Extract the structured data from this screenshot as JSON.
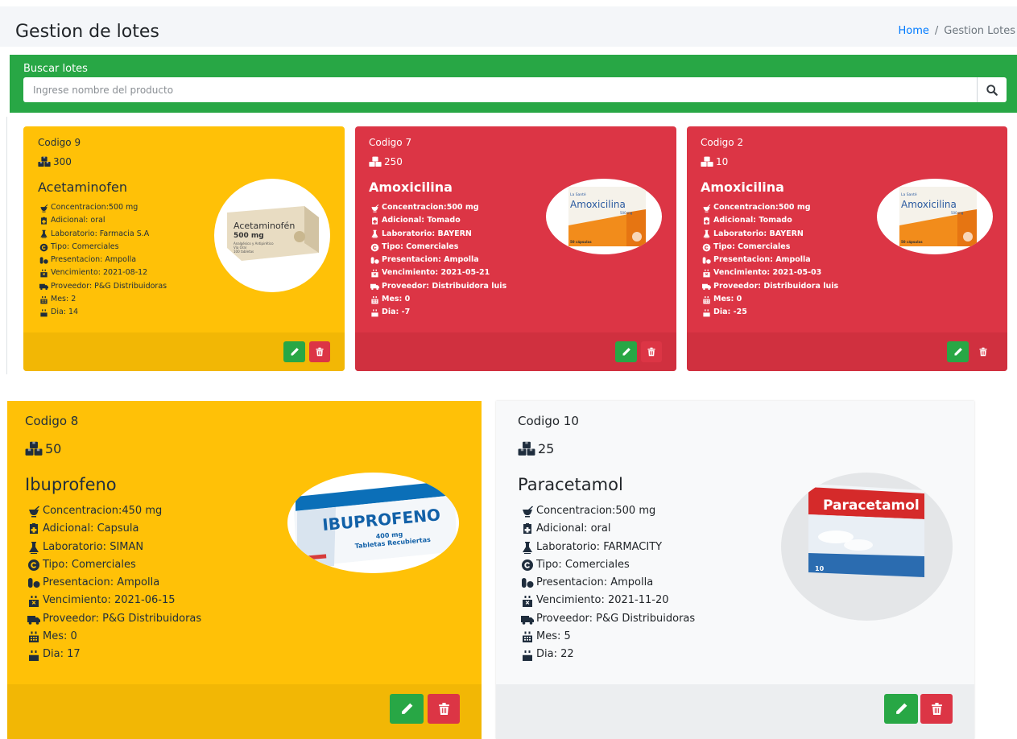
{
  "header": {
    "title": "Gestion de lotes",
    "breadcrumb": {
      "home": "Home",
      "separator": "/",
      "current": "Gestion Lotes"
    }
  },
  "search": {
    "title": "Buscar lotes",
    "placeholder": "Ingrese nombre del producto",
    "icon": "search-icon"
  },
  "colors": {
    "success": "#28a745",
    "danger": "#dc3545",
    "warning": "#ffc107",
    "light": "#f8f9fa",
    "link": "#007bff"
  },
  "cards": [
    {
      "code": "Codigo 9",
      "qty": "300",
      "name": "Acetaminofen",
      "color": "yellow",
      "image": {
        "brand": "Acetaminofén",
        "dose": "500 mg",
        "line1": "Analgésico y Antipirético",
        "line2": "Vía Oral",
        "line3": "100 tabletas"
      },
      "details": [
        "Concentracion:500 mg",
        "Adicional: oral",
        "Laboratorio: Farmacia S.A",
        "Tipo: Comerciales",
        "Presentacion: Ampolla",
        "Vencimiento: 2021-08-12",
        "Proveedor: P&G Distribuidoras",
        "Mes: 2",
        "Dia: 14"
      ]
    },
    {
      "code": "Codigo 7",
      "qty": "250",
      "name": "Amoxicilina",
      "color": "red",
      "image": {
        "brand": "Amoxicilina",
        "top": "La Santé",
        "dose": "500 mg",
        "bottom": "50 cápsulas"
      },
      "details": [
        "Concentracion:500 mg",
        "Adicional: Tomado",
        "Laboratorio: BAYERN",
        "Tipo: Comerciales",
        "Presentacion: Ampolla",
        "Vencimiento: 2021-05-21",
        "Proveedor: Distribuidora luis",
        "Mes: 0",
        "Dia: -7"
      ]
    },
    {
      "code": "Codigo 2",
      "qty": "10",
      "name": "Amoxicilina",
      "color": "red",
      "image": {
        "brand": "Amoxicilina",
        "top": "La Santé",
        "dose": "500 mg",
        "bottom": "50 cápsulas"
      },
      "details": [
        "Concentracion:500 mg",
        "Adicional: Tomado",
        "Laboratorio: BAYERN",
        "Tipo: Comerciales",
        "Presentacion: Ampolla",
        "Vencimiento: 2021-05-03",
        "Proveedor: Distribuidora luis",
        "Mes: 0",
        "Dia: -25"
      ]
    },
    {
      "code": "Codigo 8",
      "qty": "50",
      "name": "Ibuprofeno",
      "color": "yellow",
      "image": {
        "brand": "IBUPROFENO",
        "dose": "400 mg",
        "sub": "Tabletas Recubiertas",
        "top": "10 Tabletas Recubiertas"
      },
      "details": [
        "Concentracion:450 mg",
        "Adicional: Capsula",
        "Laboratorio: SIMAN",
        "Tipo: Comerciales",
        "Presentacion: Ampolla",
        "Vencimiento: 2021-06-15",
        "Proveedor: P&G Distribuidoras",
        "Mes: 0",
        "Dia: 17"
      ]
    },
    {
      "code": "Codigo 10",
      "qty": "25",
      "name": "Paracetamol",
      "color": "light",
      "image": {
        "brand": "Paracetamol",
        "count": "10"
      },
      "details": [
        "Concentracion:500 mg",
        "Adicional: oral",
        "Laboratorio: FARMACITY",
        "Tipo: Comerciales",
        "Presentacion: Ampolla",
        "Vencimiento: 2021-11-20",
        "Proveedor: P&G Distribuidoras",
        "Mes: 5",
        "Dia: 22"
      ]
    }
  ],
  "detail_icons": [
    "mortar-pestle-icon",
    "first-aid-icon",
    "flask-icon",
    "copyright-icon",
    "pills-icon",
    "calendar-times-icon",
    "truck-icon",
    "calendar-alt-icon",
    "calendar-day-icon"
  ],
  "actions": {
    "edit_icon": "pencil-icon",
    "delete_icon": "trash-icon"
  }
}
